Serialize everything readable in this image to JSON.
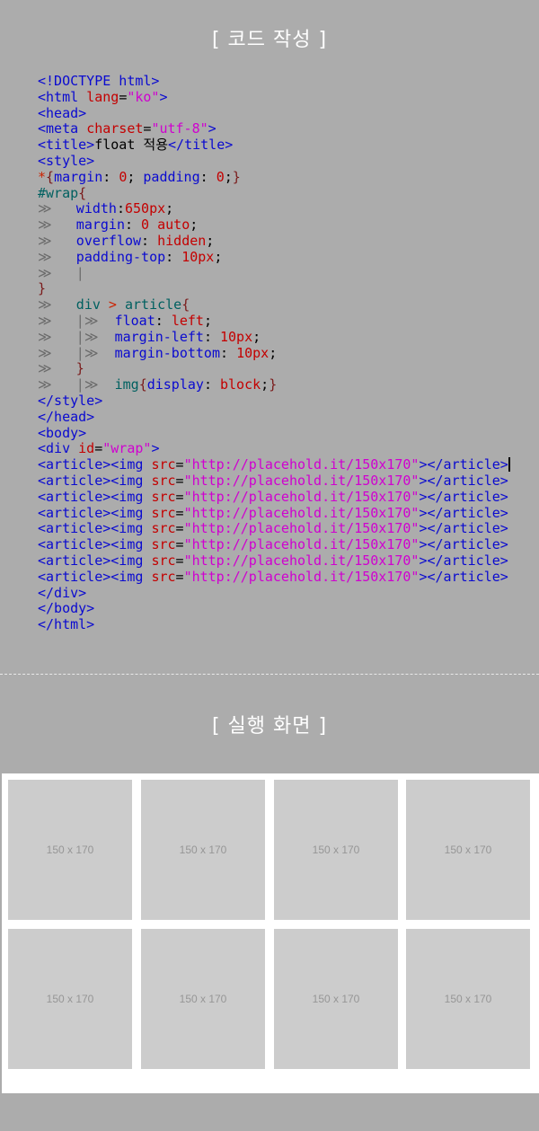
{
  "sections": {
    "code_title": "[ 코드 작성 ]",
    "result_title": "[ 실행 화면 ]"
  },
  "code": {
    "lines": [
      [
        "tag:<!DOCTYPE html>"
      ],
      [
        "tag:<html ",
        "attr:lang",
        "txt:=",
        "val:\"ko\"",
        "tag:>"
      ],
      [
        "tag:<head>"
      ],
      [
        "tag:<meta ",
        "attr:charset",
        "txt:=",
        "val:\"utf-8\"",
        "tag:>"
      ],
      [
        "tag:<title>",
        "txt:float 적용",
        "tag:</title>"
      ],
      [
        "tag:<style>"
      ],
      [
        "sym:*",
        "brace:{",
        "prop:margin",
        "txt:: ",
        "attr:0",
        "txt:; ",
        "prop:padding",
        "txt:: ",
        "attr:0",
        "txt:;",
        "brace:}"
      ],
      [
        "sel:#wrap",
        "brace:{"
      ],
      [
        "guide:≫   ",
        "prop:width",
        "txt::",
        "attr:650px",
        "txt:;"
      ],
      [
        "guide:≫   ",
        "prop:margin",
        "txt:: ",
        "attr:0 auto",
        "txt:;"
      ],
      [
        "guide:≫   ",
        "prop:overflow",
        "txt:: ",
        "attr:hidden",
        "txt:;"
      ],
      [
        "guide:≫   ",
        "prop:padding-top",
        "txt:: ",
        "attr:10px",
        "txt:;"
      ],
      [
        "guide:≫   |"
      ],
      [
        "brace:}"
      ],
      [
        "guide:≫   ",
        "sel:div ",
        "sym:> ",
        "sel:article",
        "brace:{"
      ],
      [
        "guide:≫   |≫  ",
        "prop:float",
        "txt:: ",
        "attr:left",
        "txt:;"
      ],
      [
        "guide:≫   |≫  ",
        "prop:margin-left",
        "txt:: ",
        "attr:10px",
        "txt:;"
      ],
      [
        "guide:≫   |≫  ",
        "prop:margin-bottom",
        "txt:: ",
        "attr:10px",
        "txt:;"
      ],
      [
        "guide:≫   ",
        "brace:}"
      ],
      [
        "guide:≫   |≫  ",
        "sel:img",
        "brace:{",
        "prop:display",
        "txt:: ",
        "attr:block",
        "txt:;",
        "brace:}"
      ],
      [
        "tag:</style>"
      ],
      [
        "tag:</head>"
      ],
      [
        "tag:<body>"
      ],
      [
        "tag:<div ",
        "attr:id",
        "txt:=",
        "val:\"wrap\"",
        "tag:>"
      ],
      [
        "tag:<article><img ",
        "attr:src",
        "txt:=",
        "val:\"http://placehold.it/150x170\"",
        "tag:></article>",
        "cursor:"
      ],
      [
        "tag:<article><img ",
        "attr:src",
        "txt:=",
        "val:\"http://placehold.it/150x170\"",
        "tag:></article>"
      ],
      [
        "tag:<article><img ",
        "attr:src",
        "txt:=",
        "val:\"http://placehold.it/150x170\"",
        "tag:></article>"
      ],
      [
        "tag:<article><img ",
        "attr:src",
        "txt:=",
        "val:\"http://placehold.it/150x170\"",
        "tag:></article>"
      ],
      [
        "tag:<article><img ",
        "attr:src",
        "txt:=",
        "val:\"http://placehold.it/150x170\"",
        "tag:></article>"
      ],
      [
        "tag:<article><img ",
        "attr:src",
        "txt:=",
        "val:\"http://placehold.it/150x170\"",
        "tag:></article>"
      ],
      [
        "tag:<article><img ",
        "attr:src",
        "txt:=",
        "val:\"http://placehold.it/150x170\"",
        "tag:></article>"
      ],
      [
        "tag:<article><img ",
        "attr:src",
        "txt:=",
        "val:\"http://placehold.it/150x170\"",
        "tag:></article>"
      ],
      [
        "tag:</div>"
      ],
      [
        "tag:</body>"
      ],
      [
        "tag:</html>"
      ]
    ]
  },
  "result": {
    "thumbnails": [
      "150 x 170",
      "150 x 170",
      "150 x 170",
      "150 x 170",
      "150 x 170",
      "150 x 170",
      "150 x 170",
      "150 x 170"
    ]
  },
  "colors": {
    "background": "#acacac",
    "tag": "#0a0ad0",
    "attribute": "#c40000",
    "string": "#d000d0",
    "placeholder": "#cccccc"
  }
}
